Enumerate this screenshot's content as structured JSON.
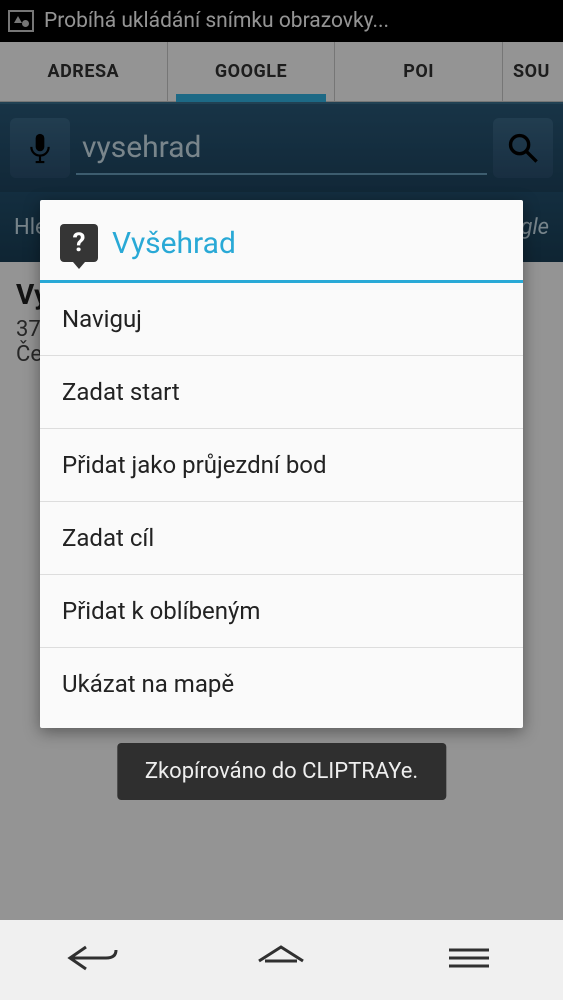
{
  "statusbar": {
    "text": "Probíhá ukládání snímku obrazovky..."
  },
  "tabs": {
    "items": [
      {
        "label": "ADRESA"
      },
      {
        "label": "GOOGLE"
      },
      {
        "label": "POI"
      },
      {
        "label": "SOU"
      }
    ]
  },
  "search": {
    "value": "vysehrad"
  },
  "hintrow": {
    "left": "Hle",
    "right": "gle"
  },
  "bgresult": {
    "title": "Vy",
    "line1": "37",
    "line2": "Če"
  },
  "dialog": {
    "title": "Vyšehrad",
    "items": [
      {
        "label": "Naviguj"
      },
      {
        "label": "Zadat start"
      },
      {
        "label": "Přidat jako průjezdní bod"
      },
      {
        "label": "Zadat cíl"
      },
      {
        "label": "Přidat k oblíbeným"
      },
      {
        "label": "Ukázat na mapě"
      }
    ]
  },
  "toast": {
    "text": "Zkopírováno do CLIPTRAYe."
  }
}
